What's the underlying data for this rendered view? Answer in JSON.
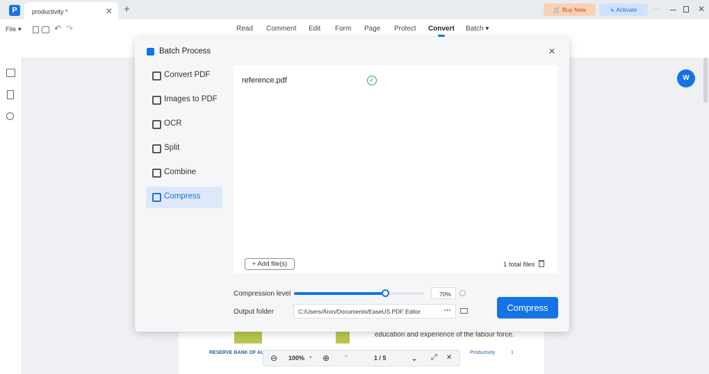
{
  "app": {
    "tab_title": "productivity *",
    "buy_now": "Buy Now",
    "activate": "Activate",
    "more": "···"
  },
  "toolbar": {
    "file": "File",
    "menu": [
      "Read",
      "Comment",
      "Edit",
      "Form",
      "Page",
      "Protect",
      "Convert",
      "Batch"
    ],
    "active": "Convert"
  },
  "dialog": {
    "title": "Batch Process",
    "sidebar": [
      {
        "label": "Convert PDF"
      },
      {
        "label": "Images to PDF"
      },
      {
        "label": "OCR"
      },
      {
        "label": "Split"
      },
      {
        "label": "Combine"
      },
      {
        "label": "Compress",
        "active": true
      }
    ],
    "files": [
      {
        "name": "reference.pdf",
        "status": "done"
      }
    ],
    "add_files": "+ Add file(s)",
    "total": "1 total files",
    "compression_label": "Compression level",
    "compression_value": "70%",
    "compression_level": 70,
    "output_label": "Output folder",
    "output_path": "C:/Users/Áron/Documents/EaseUS PDF Editor",
    "output_more": "···",
    "compress_button": "Compress"
  },
  "document": {
    "text": "education and experience of the labour force.",
    "footer_left": "RESERVE BANK OF AUS",
    "footer_right": "Productivity",
    "page_num": "1"
  },
  "viewer": {
    "zoom": "100%",
    "page": "1 / 5"
  },
  "colors": {
    "accent": "#1473e6",
    "buy_bg": "#f6d2b4",
    "activate_bg": "#cfe2fb"
  }
}
